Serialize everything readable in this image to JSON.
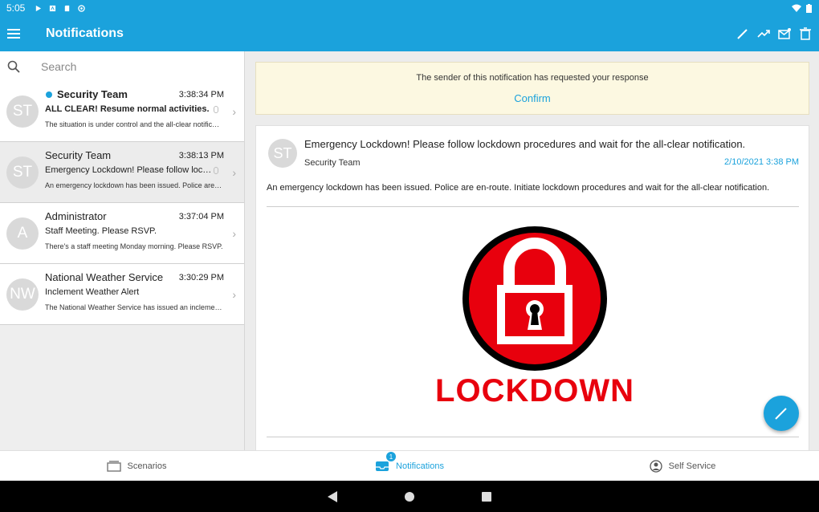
{
  "status_bar": {
    "time": "5:05"
  },
  "app_bar": {
    "title": "Notifications",
    "menu_icon": "hamburger-menu-icon",
    "actions": [
      "pencil-icon",
      "trending-icon",
      "mark-read-icon",
      "trash-icon"
    ]
  },
  "search": {
    "placeholder": "Search"
  },
  "messages": [
    {
      "initials": "ST",
      "sender": "Security Team",
      "time": "3:38:34 PM",
      "subject": "ALL CLEAR! Resume normal activities.",
      "preview": "The situation is under control and the all-clear notification has been issued.",
      "unread": true,
      "selected": false
    },
    {
      "initials": "ST",
      "sender": "Security Team",
      "time": "3:38:13 PM",
      "subject": "Emergency Lockdown! Please follow lockdown procedures",
      "preview": "An emergency lockdown has been issued. Police are en-route.",
      "unread": false,
      "selected": true
    },
    {
      "initials": "A",
      "sender": "Administrator",
      "time": "3:37:04 PM",
      "subject": "Staff Meeting. Please RSVP.",
      "preview": "There's a staff meeting Monday morning. Please RSVP.",
      "unread": false,
      "selected": false
    },
    {
      "initials": "NW",
      "sender": "National Weather Service",
      "time": "3:30:29 PM",
      "subject": "Inclement Weather Alert",
      "preview": "The National Weather Service has issued an inclement weather alert.",
      "unread": false,
      "selected": false
    }
  ],
  "banner": {
    "text": "The sender of this notification has requested your response",
    "confirm_label": "Confirm"
  },
  "detail": {
    "initials": "ST",
    "subject": "Emergency Lockdown! Please follow lockdown procedures and wait for the all-clear notification.",
    "sender": "Security Team",
    "date": "2/10/2021 3:38 PM",
    "body": "An emergency lockdown has been issued. Police are en-route. Initiate lockdown procedures and wait for the all-clear notification.",
    "image_caption": "LOCKDOWN"
  },
  "bottom_nav": {
    "items": [
      {
        "label": "Scenarios",
        "icon": "scenarios-icon"
      },
      {
        "label": "Notifications",
        "icon": "inbox-icon",
        "badge": "1"
      },
      {
        "label": "Self Service",
        "icon": "person-icon"
      }
    ]
  },
  "colors": {
    "accent": "#1ba2dc",
    "banner_bg": "#fcf8e1",
    "lockdown_red": "#e8000d"
  }
}
